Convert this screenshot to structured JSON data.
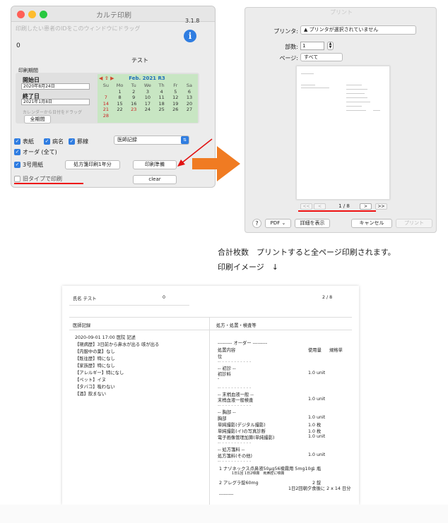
{
  "karte_window": {
    "title": "カルテ印刷",
    "drag_hint": "印刷したい患者のIDをこのウィンドウにドラッグ",
    "version": "3.1.8",
    "patient_id": "0",
    "patient_name": "テスト",
    "period_label": "印刷期間",
    "start_label": "開始日",
    "start_value": "2020年8月24日",
    "end_label": "終了日",
    "end_value": "2021年1月8日",
    "calendar_hint": "カレンダーから日付をドラッグ",
    "all_period_label": "全期間",
    "calendar": {
      "nav": "◀ ⇧ ▶",
      "month": "Feb. 2021 R3",
      "weekdays": [
        "Su",
        "Mo",
        "Tu",
        "We",
        "Th",
        "Fr",
        "Sa"
      ],
      "rows": [
        [
          "",
          "1",
          "2",
          "3",
          "4",
          "5",
          "6"
        ],
        [
          "7",
          "8",
          "9",
          "10",
          "11",
          "12",
          "13"
        ],
        [
          "14",
          "15",
          "16",
          "17",
          "18",
          "19",
          "20"
        ],
        [
          "21",
          "22",
          "23",
          "24",
          "25",
          "26",
          "27"
        ],
        [
          "28",
          "",
          "",
          "",
          "",
          "",
          ""
        ]
      ]
    },
    "options": {
      "cover": "表紙",
      "disease": "病名",
      "ikei": "罫線",
      "order_all": "オーダ (全て)",
      "no3_paper": "3号用紙",
      "old_type": "旧タイプで印刷"
    },
    "order_select_value": "医師記録",
    "rx_year_button": "処方箋印刷1年分",
    "print_prep_button": "印刷準備",
    "clear_button": "clear"
  },
  "print_dialog": {
    "title": "プリント",
    "printer_label": "プリンタ:",
    "printer_value": "▲ プリンタが選択されていません",
    "copies_label": "部数:",
    "copies_value": "1",
    "pages_label": "ページ:",
    "pages_value": "すべて",
    "nav_first": "<<",
    "nav_prev": "<",
    "page_count": "1 / 8",
    "nav_next": ">",
    "nav_last": ">>",
    "help": "?",
    "pdf": "PDF ⌄",
    "details": "詳細を表示",
    "cancel": "キャンセル",
    "print": "プリント"
  },
  "notes": {
    "line1": "合計枚数　プリントすると全ページ印刷されます。",
    "line2": "印刷イメージ　↓"
  },
  "print_image": {
    "name_label": "氏名 テスト",
    "patient_no": "0",
    "page": "2 / 8",
    "left_header": "医師記録",
    "right_header": "処方・処置・検査等",
    "record_date": "2020-09-01 17:00  医院 記述",
    "record_lines": [
      "【現病歴】3日前から鼻水が出る 咳が出る",
      "【内服中の薬】なし",
      "【既往歴】特になし",
      "【家族歴】特になし",
      "【アレルギー】特になし",
      "【ペット】イヌ",
      "【タバコ】吸わない",
      "【酒】飲まない"
    ],
    "order_title": "--------- オーダー ---------",
    "col_headers": {
      "content": "処置内容",
      "pos": "位",
      "qty": "使用量",
      "unit": "規格単"
    },
    "sections": [
      {
        "title": "-- 初診 --",
        "items": [
          {
            "name": "初診料",
            "qty": "1.0  unit"
          },
          {
            "name": "-",
            "qty": ""
          }
        ]
      },
      {
        "title": "-- 末梢血液一般 --",
        "items": [
          {
            "name": "末梢血液一般検査",
            "qty": "1.0  unit"
          }
        ]
      },
      {
        "title": "-- 胸部 --",
        "items": [
          {
            "name": "胸部",
            "qty": "1.0  unit"
          },
          {
            "name": "単純撮影(デジタル撮影)",
            "qty": "1.0  枚"
          },
          {
            "name": "単純撮影(イ)の写真診断",
            "qty": "1.0  枚"
          },
          {
            "name": "電子画像管理加算(単純撮影)",
            "qty": "1.0  unit"
          }
        ]
      },
      {
        "title": "-- 処方箋料 --",
        "items": [
          {
            "name": "処方箋料(その他)",
            "qty": "1.0  unit"
          }
        ]
      }
    ],
    "rx1_name": "1  ナゾネックス点鼻液50μg56噴霧用 5mg10g",
    "rx1_qty": "1 瓶",
    "rx1_usage": "1日1回 1日2噴霧　両鼻腔に噴霧",
    "rx2_name": "2  アレグラ錠60mg",
    "rx2_qty": "2 錠",
    "rx2_usage": "1日2回朝夕食後に 2 x 14 日分",
    "dashes": "-- - - - - - - - - - -",
    "end_dashes": "---------"
  },
  "colors": {
    "accent_blue": "#2f7de1",
    "calendar_green": "#c8e6c3",
    "annotation_orange": "#f07b22",
    "annotation_red": "#e11111"
  }
}
